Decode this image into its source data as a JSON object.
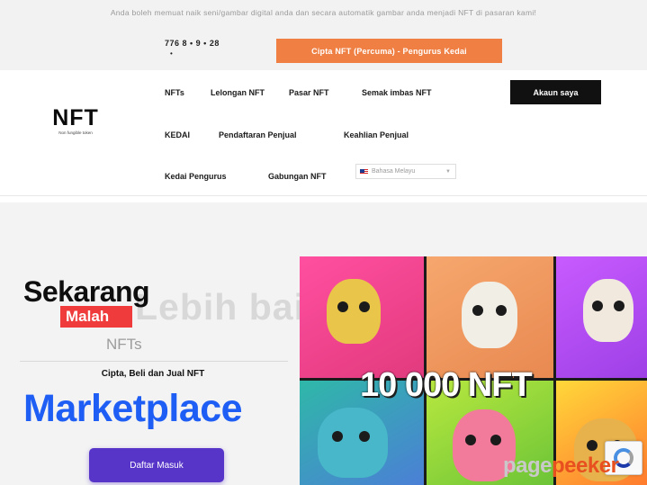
{
  "top_bar": {
    "announcement": "Anda boleh memuat naik seni/gambar digital anda dan secara automatik gambar anda menjadi NFT di pasaran kami!",
    "countdown": "776  8 •  9 •  28",
    "countdown_tail": "•",
    "cta_label": "Cipta NFT (Percuma) - Pengurus Kedai"
  },
  "logo": {
    "big": "NFT",
    "small": "Non fungible token"
  },
  "nav": {
    "items": [
      "NFTs",
      "Lelongan NFT",
      "Pasar NFT",
      "Semak imbas NFT",
      "KEDAI",
      "Pendaftaran Penjual",
      "Keahlian Penjual",
      "Kedai Pengurus",
      "Gabungan NFT"
    ],
    "account_button": "Akaun saya",
    "language": "Bahasa Melayu"
  },
  "hero": {
    "ghost_text": "Lebih baik!",
    "headline": "Sekarang",
    "highlight": "Malah",
    "subline": "NFTs",
    "tagline": "Cipta, Beli dan Jual NFT",
    "title": "Marketplace",
    "login_button": "Daftar Masuk",
    "art_label": "10 000 NFT"
  },
  "watermark": {
    "part1": "page",
    "part2": "peeker"
  },
  "colors": {
    "cta": "#ef7f43",
    "title_blue": "#1e5ef5",
    "highlight_red": "#ef3b3b",
    "login_purple": "#5835c9",
    "account_black": "#111111"
  },
  "icons": [
    "flag-icon",
    "chevron-down-icon",
    "recaptcha-icon"
  ]
}
